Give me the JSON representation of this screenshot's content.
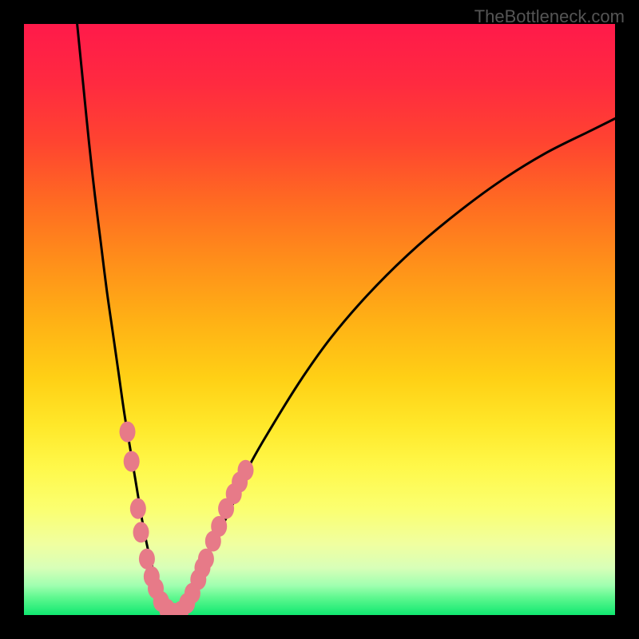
{
  "watermark": "TheBottleneck.com",
  "chart_data": {
    "type": "line",
    "title": "",
    "xlabel": "",
    "ylabel": "",
    "xlim": [
      0,
      100
    ],
    "ylim": [
      0,
      100
    ],
    "gradient_bands": [
      {
        "y": 0,
        "color": "#ff1a4a"
      },
      {
        "y": 10,
        "color": "#ff2a40"
      },
      {
        "y": 20,
        "color": "#ff4430"
      },
      {
        "y": 30,
        "color": "#ff6a22"
      },
      {
        "y": 40,
        "color": "#ff8e1a"
      },
      {
        "y": 50,
        "color": "#ffb015"
      },
      {
        "y": 60,
        "color": "#ffd015"
      },
      {
        "y": 68,
        "color": "#ffe82a"
      },
      {
        "y": 75,
        "color": "#fff84a"
      },
      {
        "y": 82,
        "color": "#fbff70"
      },
      {
        "y": 88,
        "color": "#f0ffa0"
      },
      {
        "y": 92,
        "color": "#d8ffb8"
      },
      {
        "y": 95,
        "color": "#a0ffb0"
      },
      {
        "y": 97,
        "color": "#60f890"
      },
      {
        "y": 100,
        "color": "#10e870"
      }
    ],
    "series": [
      {
        "name": "bottleneck-curve",
        "x": [
          9,
          10,
          11,
          12,
          13,
          14,
          15,
          16,
          17,
          18,
          19,
          20,
          21,
          22,
          23,
          24,
          25,
          26,
          27,
          28,
          30,
          32,
          35,
          38,
          42,
          47,
          52,
          58,
          65,
          72,
          80,
          88,
          96,
          100
        ],
        "y": [
          100,
          90,
          80,
          71,
          63,
          55,
          48,
          41,
          34,
          28,
          22,
          16,
          11,
          7,
          3,
          1,
          0,
          0,
          1,
          3,
          7,
          12,
          18,
          25,
          32,
          40,
          47,
          54,
          61,
          67,
          73,
          78,
          82,
          84
        ]
      }
    ],
    "dots": [
      {
        "x": 17.5,
        "y": 31
      },
      {
        "x": 18.2,
        "y": 26
      },
      {
        "x": 19.3,
        "y": 18
      },
      {
        "x": 19.8,
        "y": 14
      },
      {
        "x": 20.8,
        "y": 9.5
      },
      {
        "x": 21.6,
        "y": 6.5
      },
      {
        "x": 22.3,
        "y": 4.5
      },
      {
        "x": 23.2,
        "y": 2.3
      },
      {
        "x": 24.2,
        "y": 1
      },
      {
        "x": 25.3,
        "y": 0.3
      },
      {
        "x": 26.5,
        "y": 0.6
      },
      {
        "x": 27.6,
        "y": 2
      },
      {
        "x": 28.5,
        "y": 3.7
      },
      {
        "x": 29.5,
        "y": 6
      },
      {
        "x": 30.2,
        "y": 8
      },
      {
        "x": 30.8,
        "y": 9.5
      },
      {
        "x": 32,
        "y": 12.5
      },
      {
        "x": 33,
        "y": 15
      },
      {
        "x": 34.2,
        "y": 18
      },
      {
        "x": 35.5,
        "y": 20.5
      },
      {
        "x": 36.5,
        "y": 22.5
      },
      {
        "x": 37.5,
        "y": 24.5
      }
    ],
    "dot_color": "#e77a88",
    "curve_color": "#000000"
  }
}
